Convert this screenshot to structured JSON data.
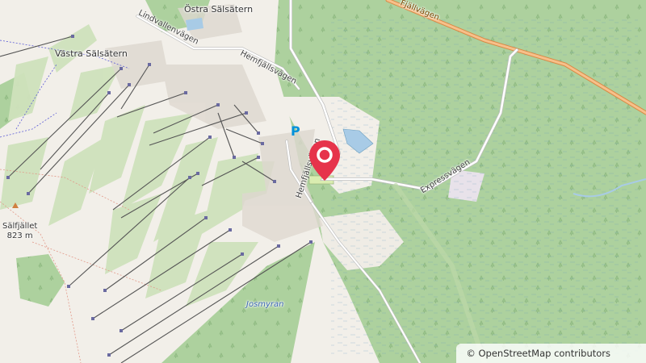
{
  "map": {
    "labels": {
      "ostra_salsatern": "Östra Sälsätern",
      "vastra_salsatern": "Västra Sälsätern",
      "lindvallenvagen": "Lindvallenvägen",
      "hemfjallsvagen": "Hemfjällsvägen",
      "hemfjallsvagen_2": "Hemfjällsvägen",
      "expressvagen": "Expressvägen",
      "fjallvagen": "Fjällvägen",
      "salfjallet": "Sälfjället",
      "salfjallet_elev": "823 m",
      "josmyran": "Josmyran"
    },
    "parking_symbol": "P",
    "marker_icon": "location-pin-icon",
    "attribution": "© OpenStreetMap contributors",
    "colors": {
      "land": "#f2efe9",
      "forest": "#add19e",
      "piste": "#d8e8c8",
      "marker": "#e6334b",
      "road_orange": "#f0a060",
      "water": "#a8cbe6",
      "parking": "#0092da"
    }
  }
}
